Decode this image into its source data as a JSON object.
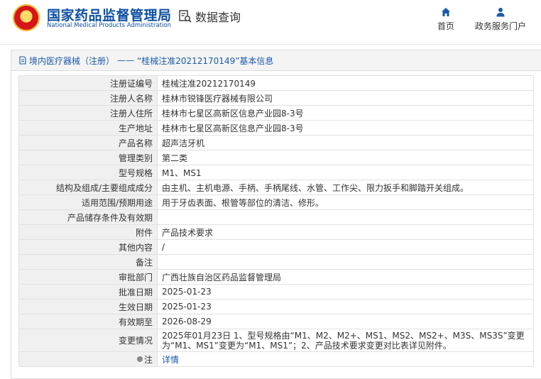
{
  "header": {
    "org_cn": "国家药品监督管理局",
    "org_en": "National Medical Products Administration",
    "query_label": "数据查询",
    "nav": {
      "home": "首页",
      "portal": "政务服务门户"
    }
  },
  "breadcrumb": {
    "category": "境内医疗器械（注册）",
    "separator": "——",
    "title": "“桂械注准20212170149”基本信息"
  },
  "rows": [
    {
      "label": "注册证编号",
      "value": "桂械注准20212170149"
    },
    {
      "label": "注册人名称",
      "value": "桂林市锐锋医疗器械有限公司"
    },
    {
      "label": "注册人住所",
      "value": "桂林市七星区高新区信息产业园8-3号"
    },
    {
      "label": "生产地址",
      "value": "桂林市七星区高新区信息产业园8-3号"
    },
    {
      "label": "产品名称",
      "value": "超声洁牙机"
    },
    {
      "label": "管理类别",
      "value": "第二类"
    },
    {
      "label": "型号规格",
      "value": "M1、MS1"
    },
    {
      "label": "结构及组成/主要组成成分",
      "value": "由主机、主机电源、手柄、手柄尾线、水管、工作尖、限力扳手和脚踏开关组成。"
    },
    {
      "label": "适用范围/预期用途",
      "value": "用于牙齿表面、根管等部位的清洁、修形。"
    },
    {
      "label": "产品储存条件及有效期",
      "value": ""
    },
    {
      "label": "附件",
      "value": "产品技术要求"
    },
    {
      "label": "其他内容",
      "value": "/"
    },
    {
      "label": "备注",
      "value": ""
    },
    {
      "label": "审批部门",
      "value": "广西壮族自治区药品监督管理局"
    },
    {
      "label": "批准日期",
      "value": "2025-01-23"
    },
    {
      "label": "生效日期",
      "value": "2025-01-23"
    },
    {
      "label": "有效期至",
      "value": "2026-08-29"
    },
    {
      "label": "变更情况",
      "value": "2025年01月23日 1、型号规格由“M1、M2、M2+、MS1、MS2、MS2+、M3S、MS3S”变更为“M1、MS1”变更为“M1、MS1”；2、产品技术要求变更对比表详见附件。"
    },
    {
      "label": "注",
      "value": "详情"
    }
  ],
  "colors": {
    "brand_blue": "#0d4fa3",
    "link_blue": "#1a5aa8",
    "label_bg": "#f0f0f0"
  }
}
